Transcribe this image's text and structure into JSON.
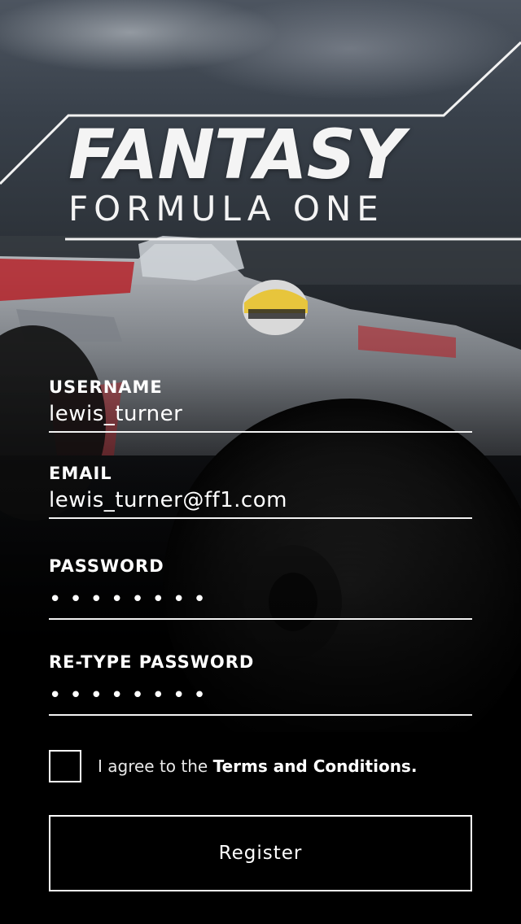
{
  "logo": {
    "title": "FANTASY",
    "subtitle": "FORMULA ONE"
  },
  "form": {
    "username": {
      "label": "USERNAME",
      "value": "lewis_turner"
    },
    "email": {
      "label": "EMAIL",
      "value": "lewis_turner@ff1.com"
    },
    "password": {
      "label": "PASSWORD",
      "value": "••••••••"
    },
    "retype_password": {
      "label": "RE-TYPE PASSWORD",
      "value": "••••••••"
    }
  },
  "agreement": {
    "prefix": "I agree to the ",
    "link": "Terms and Conditions.",
    "checked": false
  },
  "register_label": "Register",
  "colors": {
    "background": "#000000",
    "text": "#ffffff",
    "car_red": "#b5232a"
  }
}
